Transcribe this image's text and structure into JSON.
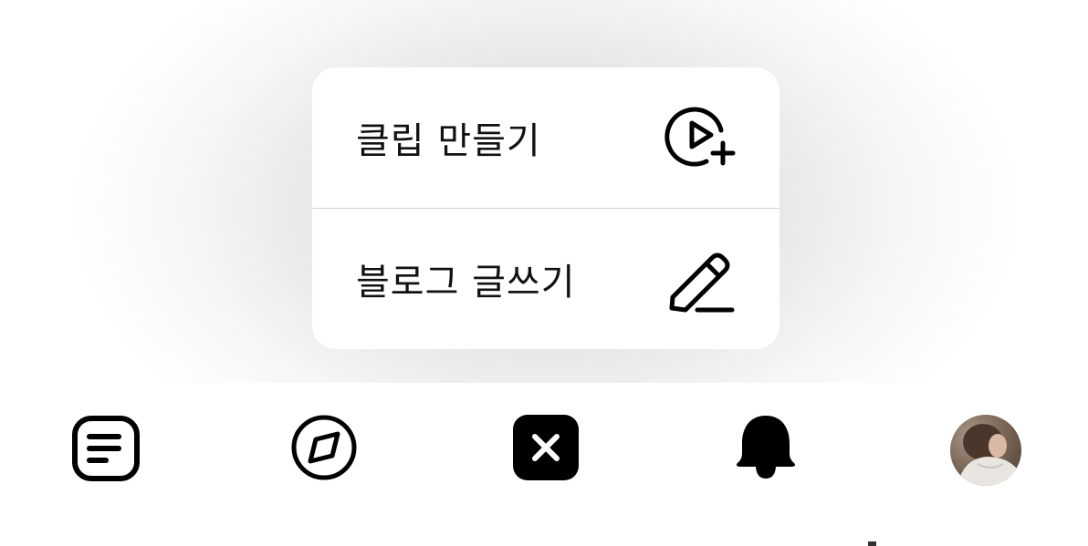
{
  "menu": {
    "items": [
      {
        "label": "클립 만들기",
        "icon": "clip-create-icon"
      },
      {
        "label": "블로그 글쓰기",
        "icon": "pencil-icon"
      }
    ]
  },
  "tabbar": {
    "items": [
      {
        "icon": "feed-icon"
      },
      {
        "icon": "compass-icon"
      },
      {
        "icon": "close-icon"
      },
      {
        "icon": "bell-icon"
      },
      {
        "icon": "profile-avatar"
      }
    ]
  },
  "colors": {
    "text": "#111111",
    "icon": "#000000",
    "divider": "#d6d6d6",
    "background": "#ffffff"
  }
}
